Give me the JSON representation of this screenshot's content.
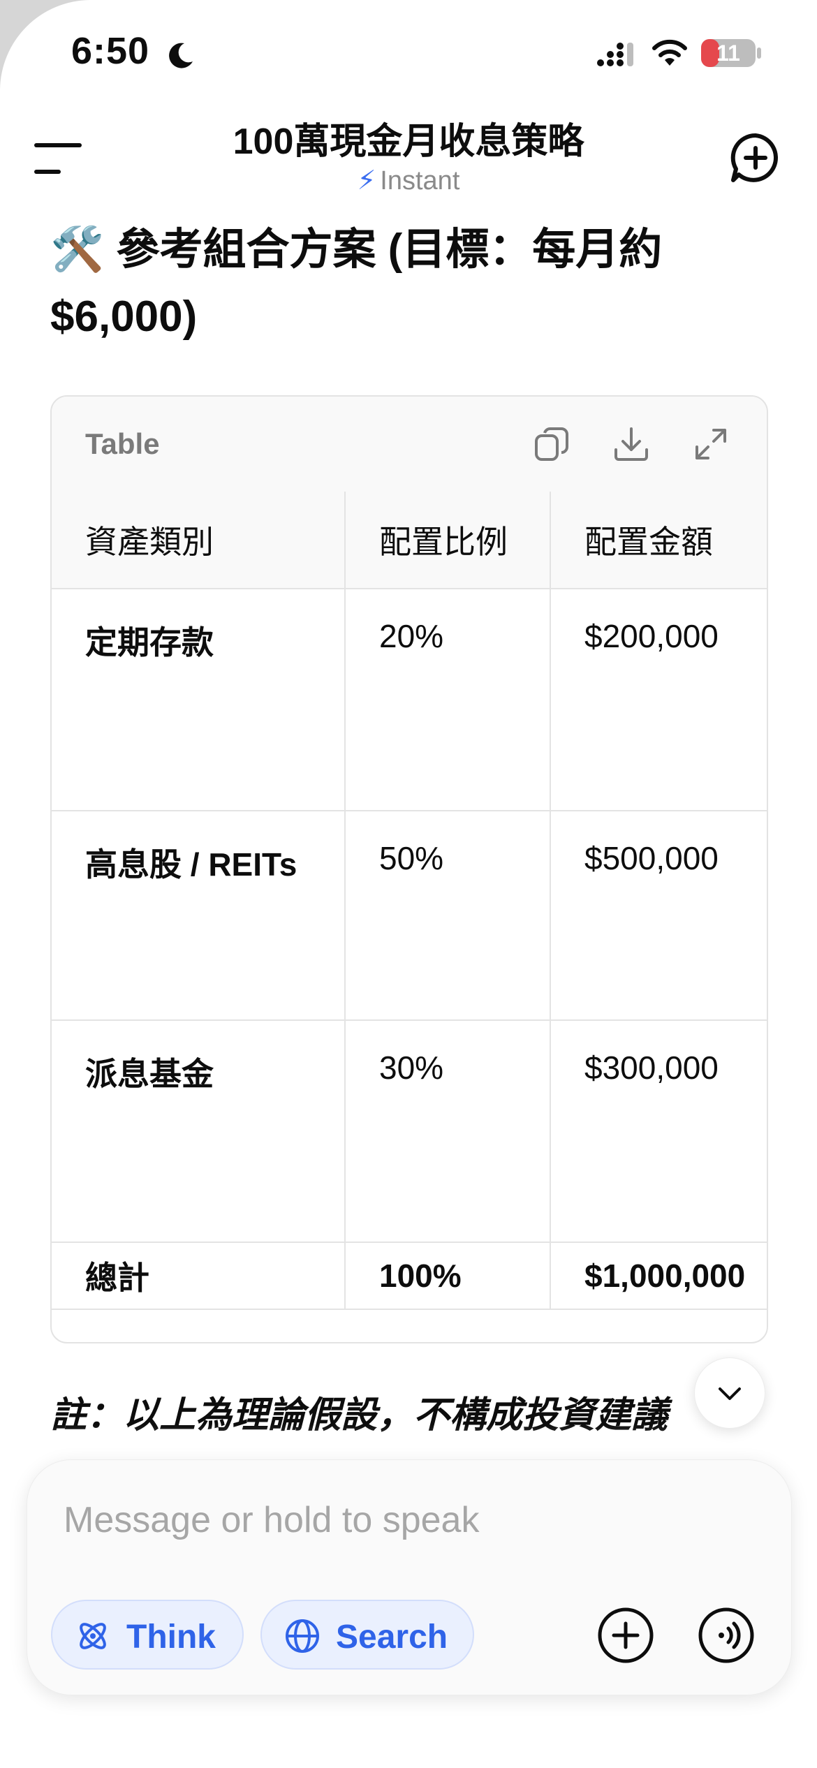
{
  "status_bar": {
    "time": "6:50",
    "battery": "11"
  },
  "header": {
    "title": "100萬現金月收息策略",
    "model_icon": "lightning-bolt-icon",
    "model": "Instant"
  },
  "content": {
    "heading_emoji": "🛠️",
    "heading": "參考組合方案 (目標：每月約 $6,000)",
    "table": {
      "label": "Table",
      "columns": [
        "資產類別",
        "配置比例",
        "配置金額"
      ],
      "rows": [
        [
          "定期存款",
          "20%",
          "$200,000"
        ],
        [
          "高息股 / REITs",
          "50%",
          "$500,000"
        ],
        [
          "派息基金",
          "30%",
          "$300,000"
        ],
        [
          "總計",
          "100%",
          "$1,000,000"
        ]
      ]
    },
    "note": "註：以上為理論假設，不構成投資建議"
  },
  "composer": {
    "placeholder": "Message or hold to speak",
    "think_label": "Think",
    "search_label": "Search"
  },
  "colors": {
    "accent": "#2f63e8",
    "battery_red": "#e5484d"
  }
}
